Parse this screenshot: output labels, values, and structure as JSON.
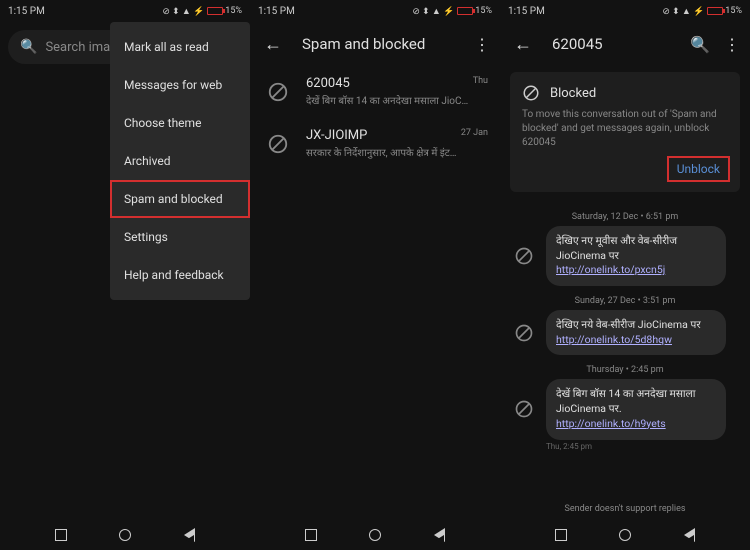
{
  "status": {
    "time": "1:15 PM",
    "battery": "15%"
  },
  "screen1": {
    "search_placeholder": "Search images",
    "menu": {
      "mark_read": "Mark all as read",
      "web": "Messages for web",
      "theme": "Choose theme",
      "archived": "Archived",
      "spam": "Spam and blocked",
      "settings": "Settings",
      "help": "Help and feedback"
    }
  },
  "screen2": {
    "title": "Spam and blocked",
    "items": [
      {
        "title": "620045",
        "snippet": "देखें बिग बॉस 14 का अनदेखा मसाला JioCine...",
        "time": "Thu"
      },
      {
        "title": "JX-JIOIMP",
        "snippet": "सरकार के निर्देशानुसार, आपके क्षेत्र में इंटरनेट...",
        "time": "27 Jan"
      }
    ]
  },
  "screen3": {
    "title": "620045",
    "banner": {
      "title": "Blocked",
      "desc": "To move this conversation out of 'Spam and blocked' and get messages again, unblock 620045",
      "action": "Unblock"
    },
    "groups": [
      {
        "date": "Saturday, 12 Dec • 6:51 pm",
        "text": "देखिए नए मूवीस और वेब-सीरीज JioCinema पर ",
        "link": "http://onelink.to/pxcn5j"
      },
      {
        "date": "Sunday, 27 Dec • 3:51 pm",
        "text": "देखिए नये वेब-सीरीज JioCinema पर ",
        "link": "http://onelink.to/5d8hqw"
      },
      {
        "date": "Thursday • 2:45 pm",
        "text": "देखें बिग बॉस 14 का अनदेखा मसाला JioCinema पर. ",
        "link": "http://onelink.to/h9yets",
        "time_below": "Thu, 2:45 pm"
      }
    ],
    "footer": "Sender doesn't support replies"
  }
}
